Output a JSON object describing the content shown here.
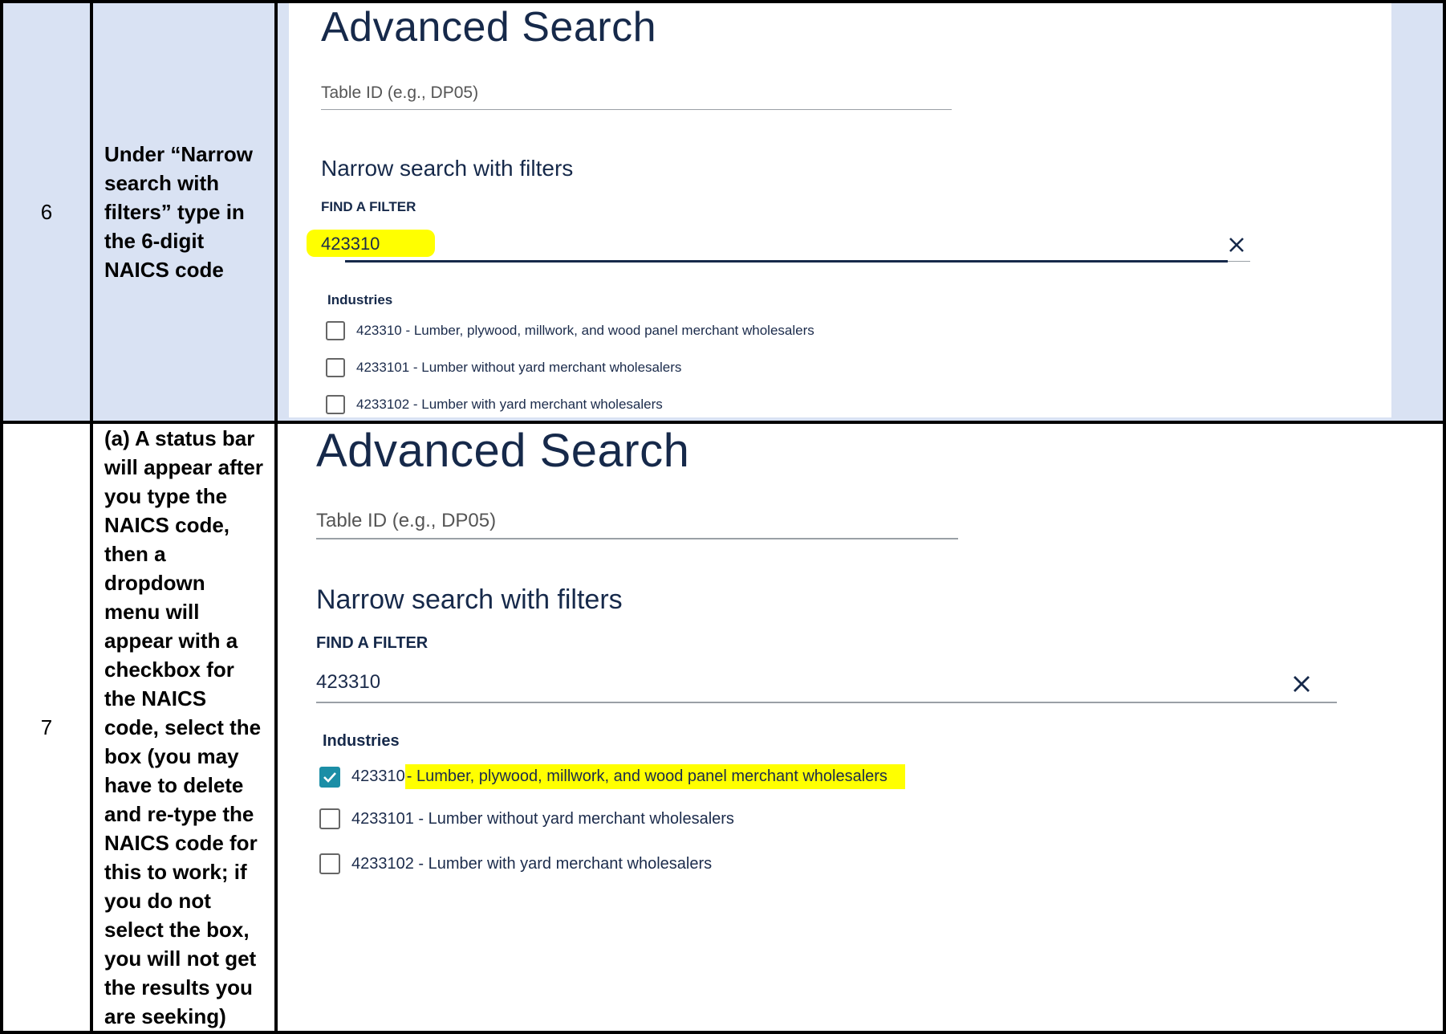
{
  "steps": [
    {
      "number": "6",
      "instruction": "Under “Narrow search with filters” type in the 6-digit NAICS code"
    },
    {
      "number": "7",
      "instruction": "(a) A status bar will appear after you type the NAICS code, then a dropdown menu will appear with a checkbox for the NAICS code, select the box (you may have to delete and re-type the NAICS code for this to work; if you do not select the box, you will not get the results you are seeking)"
    }
  ],
  "screens": [
    {
      "title": "Advanced Search",
      "table_id_placeholder": "Table ID (e.g., DP05)",
      "narrow_heading": "Narrow search with filters",
      "find_filter_label": "FIND A FILTER",
      "filter_value": "423310",
      "industries_heading": "Industries",
      "options": [
        {
          "code": "423310",
          "label": "423310 - Lumber, plywood, millwork, and wood panel merchant wholesalers",
          "checked": false
        },
        {
          "code": "4233101",
          "label": "4233101 - Lumber without yard merchant wholesalers",
          "checked": false
        },
        {
          "code": "4233102",
          "label": "4233102 - Lumber with yard merchant wholesalers",
          "checked": false
        }
      ]
    },
    {
      "title": "Advanced Search",
      "table_id_placeholder": "Table ID (e.g., DP05)",
      "narrow_heading": "Narrow search with filters",
      "find_filter_label": "FIND A FILTER",
      "filter_value": "423310",
      "industries_heading": "Industries",
      "options": [
        {
          "code": "423310",
          "code_text": "423310 ",
          "label": "- Lumber, plywood, millwork, and wood panel merchant wholesalers",
          "checked": true
        },
        {
          "code": "4233101",
          "label": "4233101 - Lumber without yard merchant wholesalers",
          "checked": false
        },
        {
          "code": "4233102",
          "label": "4233102 - Lumber with yard merchant wholesalers",
          "checked": false
        }
      ]
    }
  ],
  "colors": {
    "row_highlight": "#d9e2f3",
    "checkbox_checked": "#1b8ea6",
    "marker_highlight": "#ffff00",
    "heading_text": "#16294a"
  },
  "icons": [
    "close-icon",
    "checkmark-icon"
  ]
}
